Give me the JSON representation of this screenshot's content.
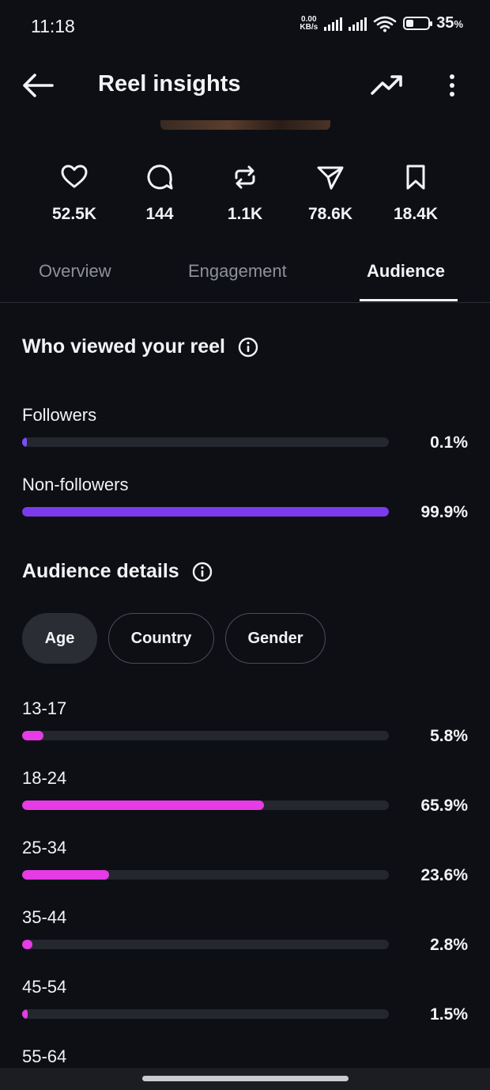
{
  "status": {
    "time": "11:18",
    "speed_value": "0.00",
    "speed_unit": "KB/s",
    "battery_pct": "35",
    "battery_unit": "%",
    "battery_level": 0.35
  },
  "header": {
    "title": "Reel insights"
  },
  "stats": [
    {
      "icon": "heart-icon",
      "value": "52.5K"
    },
    {
      "icon": "comment-icon",
      "value": "144"
    },
    {
      "icon": "repost-icon",
      "value": "1.1K"
    },
    {
      "icon": "send-icon",
      "value": "78.6K"
    },
    {
      "icon": "bookmark-icon",
      "value": "18.4K"
    }
  ],
  "tabs": [
    "Overview",
    "Engagement",
    "Audience"
  ],
  "active_tab": "Audience",
  "viewers": {
    "heading": "Who viewed your reel",
    "rows": [
      {
        "label": "Followers",
        "pct": "0.1%",
        "value": 0.1,
        "color": "#7c4dff"
      },
      {
        "label": "Non-followers",
        "pct": "99.9%",
        "value": 99.9,
        "color": "#7c3aed"
      }
    ]
  },
  "audience": {
    "heading": "Audience details",
    "chips": [
      "Age",
      "Country",
      "Gender"
    ],
    "selected_chip": "Age",
    "bar_color": "#e63be5",
    "rows": [
      {
        "label": "13-17",
        "pct": "5.8%",
        "value": 5.8
      },
      {
        "label": "18-24",
        "pct": "65.9%",
        "value": 65.9
      },
      {
        "label": "25-34",
        "pct": "23.6%",
        "value": 23.6
      },
      {
        "label": "35-44",
        "pct": "2.8%",
        "value": 2.8
      },
      {
        "label": "45-54",
        "pct": "1.5%",
        "value": 1.5
      },
      {
        "label": "55-64",
        "pct": "",
        "value": null
      }
    ]
  }
}
